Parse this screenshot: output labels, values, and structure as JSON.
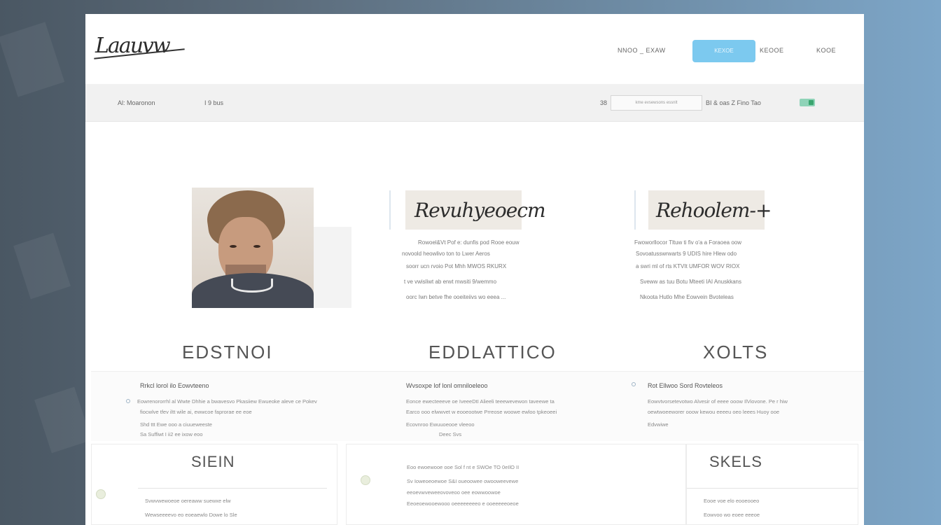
{
  "header": {
    "logo": "Laauvw",
    "nav": [
      "NNOO _ EXAW",
      "KEOOE",
      "KOOE"
    ],
    "cta_label": "KEXOE"
  },
  "toolbar": {
    "left_label": "Al: Moaronon",
    "left_count": "I  9 bus",
    "search_prefix": "38",
    "search_placeholder": "kme evsewsons essnlt",
    "right_text": "BI & oas Z Fino  Tao"
  },
  "profile": {
    "col2": {
      "title": "Revuhyeoecm",
      "lines": [
        "Rowoel&Vt Pof e: dunfis pod Rooe eouw",
        "novoold heowlivo ton to Lwer Aeros",
        "soorr ucn rvoio Pot Mhh MWOS RKURX",
        "t ve vwisliwt ab erwt mwsiti 9/wemmo",
        "oorc Iwn betve fhe ooeiteiivs wo eeea ..."
      ]
    },
    "col3": {
      "title": "Rehoolem-+",
      "lines": [
        "Fwoworllocor Tltuw ti fiv o'a a Foraoea oow",
        "Sovoatusswrwarts 9 UDIS hire Hlew odo",
        "a swri ml of rts KTVIt UMFOR WOV RIOX",
        "Sveww as tuu Botu Mteeti IAI Anuskkans",
        "Nkoota Hutlo Mhe Eowvein Bvoteleas"
      ]
    }
  },
  "sections": [
    {
      "title": "EDSTNOI",
      "item_title": "Rrkcl lorol ilo Eowvteeno",
      "lines": [
        "Eowrenororrhl al Wwte Dhhie a bwavesvo  Pkasiiew Ewueoke aleve ce Pokev",
        "fiocwlve tfev iltt wile ai, ewwcoe faprorae ee eoe",
        "Shd ttt Ewe ooo a ciuueweeste",
        "Sa Suffiwt I ii2 ee ixow eoo"
      ]
    },
    {
      "title": "EDDLATTICO",
      "item_title": "Wvsoxpe lof lonl omniloeleoo",
      "lines": [
        "Eonce ewecteeeve oe IveeeDtI Alieeli teeewevewon taveewe ta",
        "Earco ooo elwwvet w eooeootwe Prreose woowe ewloo tpkeoeei",
        "Ecovnroo Ewuuoeooe  vleeoo",
        "Deec Svs"
      ]
    },
    {
      "title": "XOLTS",
      "item_title": "Rot Ellwoo Sord Rovteleos",
      "lines": [
        "Eowvtvorsetevotwo Alvesir of eeee ooow IlViovone.  Pe r hiw",
        "oewtwoeeworer ooow kewou eeeeu oeo leees Huoy ooe",
        "Edvwiwe"
      ]
    }
  ],
  "cards": [
    {
      "title": "SIEIN",
      "lines": [
        "Svwvwewoeoe oereaww suewxe elw",
        "Wewseeeevo eo eoeaewlo Dowe lo Sle"
      ]
    },
    {
      "title": "",
      "lines": [
        "Eoo ewoewooe ooe Sol f nt e SWOe TO 0eIlO II",
        "Sv Ioweoeoewoe S&I oueoowee owooweevewe",
        "eeoevwveweeovoveoo oee eowwoowoe",
        "Eeoeoewooewooo oeeeeeeeeo e ooeeeeeoeoe"
      ]
    },
    {
      "title": "SKELS",
      "lines": [
        "Eooe voe elo eooeooeo",
        "Eowvoo wo eoee eeeoe"
      ]
    }
  ]
}
